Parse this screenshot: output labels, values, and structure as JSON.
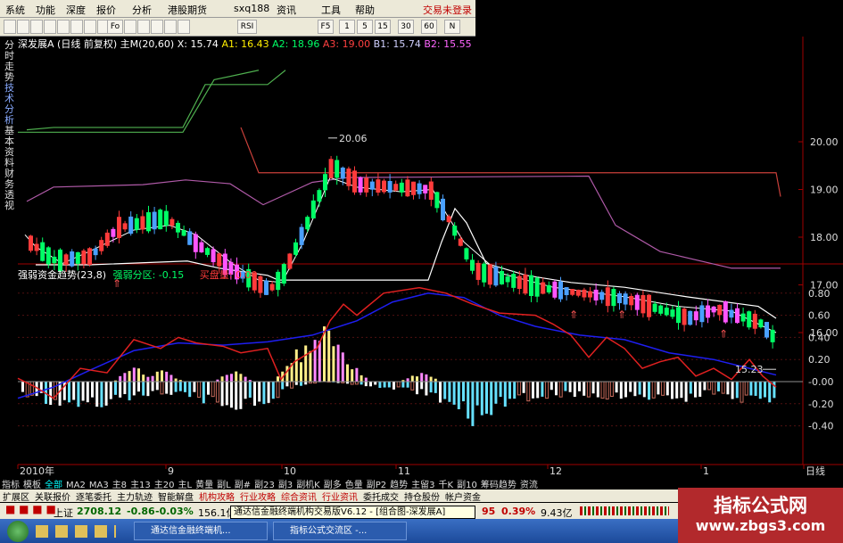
{
  "menu": {
    "items": [
      "系统",
      "功能",
      "深度",
      "报价",
      "分析",
      "港股期货",
      "sxq188",
      "资讯",
      "工具",
      "帮助"
    ],
    "trade_status": "交易未登录"
  },
  "toolbar": {
    "labels": [
      "Fo",
      "RSI",
      "F5",
      "1",
      "5",
      "15",
      "30",
      "60",
      "N"
    ]
  },
  "sidetabs": [
    "分时走势",
    "技术分析",
    "基本资料",
    "财务透视"
  ],
  "price_info": {
    "name": "深发展A",
    "mode": "(日线 前复权)",
    "ma": "主M(20,60)",
    "x": "X: 15.74",
    "a1": "A1: 16.43",
    "a2": "A2: 18.96",
    "a3": "A3: 19.00",
    "b1": "B1: 15.74",
    "b2": "B2: 15.55"
  },
  "price_axis": [
    "20.00",
    "19.00",
    "18.00",
    "17.00",
    "16.00"
  ],
  "annotations": {
    "high": "20.06",
    "low": "15.23"
  },
  "indicator": {
    "title": "强弱资金趋势(23,8)",
    "sub": "强弱分区: -0.15",
    "buy": "买盘量: 0.00"
  },
  "indicator_axis": [
    "0.80",
    "0.60",
    "0.40",
    "0.20",
    "-0.00",
    "-0.20",
    "-0.40"
  ],
  "date_axis": [
    "2010年",
    "9",
    "10",
    "11",
    "12",
    "1",
    "日线"
  ],
  "tabs": [
    "指标",
    "模板",
    "全部",
    "MA2",
    "MA3",
    "主8",
    "主13",
    "主20",
    "主L",
    "黄量",
    "副L",
    "副#",
    "副23",
    "副3",
    "副机K",
    "副多",
    "色量",
    "副P2",
    "趋势",
    "主留3",
    "千K",
    "副10",
    "筹码趋势",
    "资流"
  ],
  "tabs2": [
    "扩展区",
    "关联报价",
    "逐笔委托",
    "主力轨迹",
    "智能解盘",
    "机构攻略",
    "行业攻略",
    "综合资讯",
    "行业资讯",
    "委托成交",
    "持仓股份",
    "帐户资金"
  ],
  "status": {
    "index_name": "上证",
    "index_value": "2708.12",
    "change": "-0.86",
    "pct": "-0.03%",
    "amount": "156.1亿",
    "right_a": "95",
    "right_pct": "0.39%",
    "right_amt": "9.43亿"
  },
  "tooltip": "通达信金融终端机构交易版V6.12 - [组合图-深发展A]",
  "taskbar": {
    "tasks": [
      "通达信金融终端机...",
      "指标公式交流区 -..."
    ]
  },
  "watermark": {
    "line1": "指标公式网",
    "line2": "www.zbgs3.com"
  },
  "colors": {
    "up": "#ff3b3b",
    "down": "#00ff66",
    "ma_white": "#ffffff",
    "ma_purple": "#b05aa8",
    "ma_green": "#4fb04f",
    "ma_red": "#c9403a",
    "blue_line": "#1e1ef0",
    "red_line": "#e02020"
  }
}
